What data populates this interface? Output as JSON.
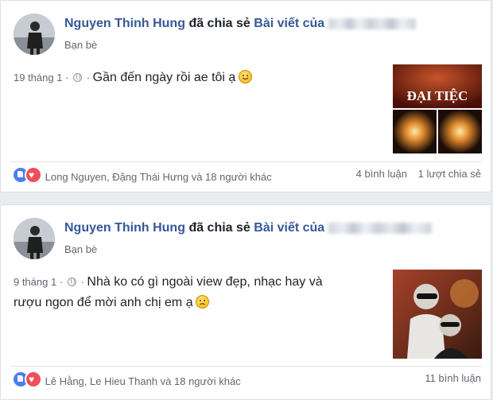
{
  "posts": [
    {
      "author": "Nguyen Thinh Hung",
      "verb": "đã chia sẻ",
      "shared_link": "Bài viết của",
      "audience": "Bạn bè",
      "date": "19 tháng 1",
      "separator": "·",
      "text": "Gần đến ngày rồi ae tôi ạ",
      "thumbnail_text": "ĐẠI TIỆC",
      "reactions_text": "Long Nguyen, Đặng Thái Hưng và 18 người khác",
      "comments": "4 bình luận",
      "shares": "1 lượt chia sẻ"
    },
    {
      "author": "Nguyen Thinh Hung",
      "verb": "đã chia sẻ",
      "shared_link": "Bài viết của",
      "audience": "Bạn bè",
      "date": "9 tháng 1",
      "separator": "·",
      "text_line1": "Nhà ko có gì ngoài view đẹp, nhạc hay và",
      "text_line2": "rượu ngon để mời anh chị em ạ",
      "reactions_text": "Lê Hằng, Le Hieu Thanh và 18 người khác",
      "comments": "11 bình luận"
    }
  ],
  "colors": {
    "link": "#365899",
    "secondary": "#616770",
    "background": "#e9ebee"
  },
  "icons": [
    "globe-icon",
    "like-reaction-icon",
    "love-reaction-icon",
    "smile-emoji-icon",
    "sad-emoji-icon"
  ]
}
